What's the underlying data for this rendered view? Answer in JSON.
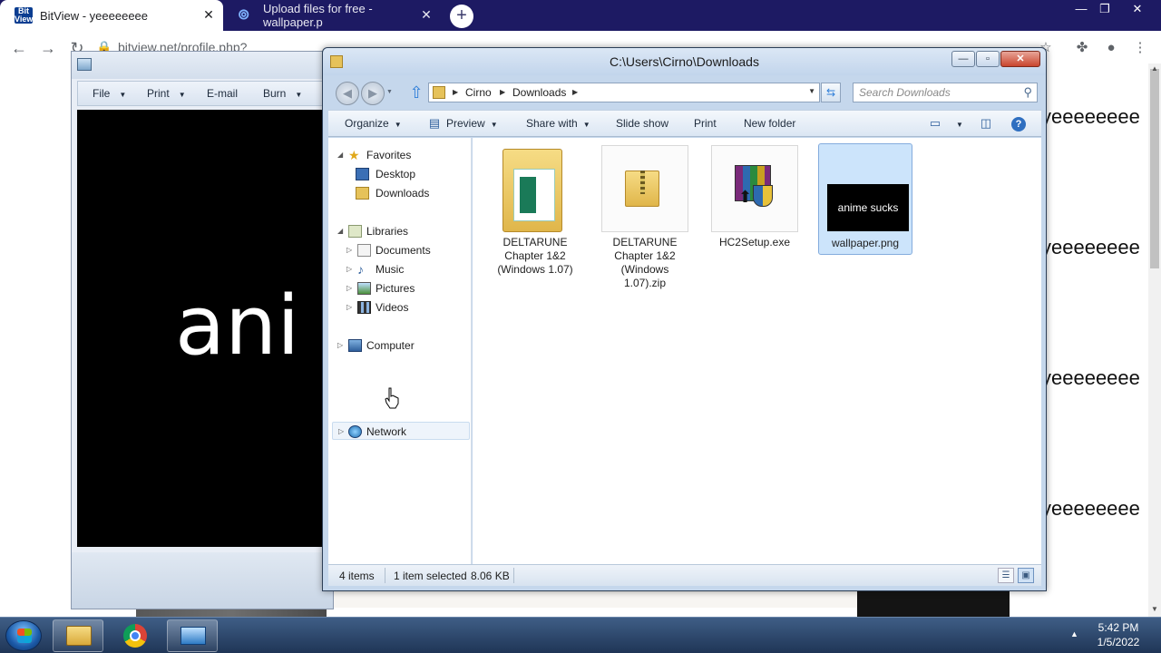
{
  "chrome": {
    "tabs": [
      {
        "title": "BitView - yeeeeeeee",
        "favicon": "Bit View",
        "close": "✕"
      },
      {
        "title": "Upload files for free - wallpaper.p",
        "close": "✕"
      }
    ],
    "new_tab": "+",
    "url": "bitview.net/profile.php?user=yeeeeeeee",
    "window_controls": {
      "minimize": "—",
      "restore": "❐",
      "close": "✕"
    }
  },
  "page": {
    "repeated_text": "yeeeeeeee"
  },
  "photo_viewer": {
    "menu": [
      {
        "label": "File",
        "has_arrow": true
      },
      {
        "label": "Print",
        "has_arrow": true
      },
      {
        "label": "E-mail",
        "has_arrow": false
      },
      {
        "label": "Burn",
        "has_arrow": true
      }
    ],
    "image_text": "ani"
  },
  "explorer": {
    "title": "C:\\Users\\Cirno\\Downloads",
    "controls": {
      "minimize": "—",
      "maximize": "▫",
      "close": "✕"
    },
    "breadcrumb": [
      "Cirno",
      "Downloads"
    ],
    "search_placeholder": "Search Downloads",
    "commands": [
      {
        "label": "Organize",
        "has_arrow": true
      },
      {
        "label": "Preview",
        "has_arrow": true
      },
      {
        "label": "Share with",
        "has_arrow": true
      },
      {
        "label": "Slide show",
        "has_arrow": false
      },
      {
        "label": "Print",
        "has_arrow": false
      },
      {
        "label": "New folder",
        "has_arrow": false
      }
    ],
    "help": "?",
    "nav": {
      "favorites": {
        "label": "Favorites",
        "items": [
          "Desktop",
          "Downloads"
        ]
      },
      "libraries": {
        "label": "Libraries",
        "items": [
          "Documents",
          "Music",
          "Pictures",
          "Videos"
        ]
      },
      "computer": "Computer",
      "network": "Network"
    },
    "files": [
      {
        "name": "DELTARUNE Chapter 1&2 (Windows 1.07)",
        "type": "folder",
        "selected": false
      },
      {
        "name": "DELTARUNE Chapter 1&2 (Windows 1.07).zip",
        "type": "zip",
        "selected": false
      },
      {
        "name": "HC2Setup.exe",
        "type": "exe",
        "selected": false
      },
      {
        "name": "wallpaper.png",
        "type": "png",
        "selected": true,
        "thumb_text": "anime sucks"
      }
    ],
    "status": {
      "items": "4 items",
      "selected": "1 item selected",
      "size": "8.06 KB"
    }
  },
  "taskbar": {
    "clock_time": "5:42 PM",
    "clock_date": "1/5/2022",
    "tray_arrow": "▲"
  },
  "colors": {
    "chrome_tabstrip": "#1d1a63",
    "taskbar": "#2a4670",
    "selection": "#cce4fb"
  }
}
